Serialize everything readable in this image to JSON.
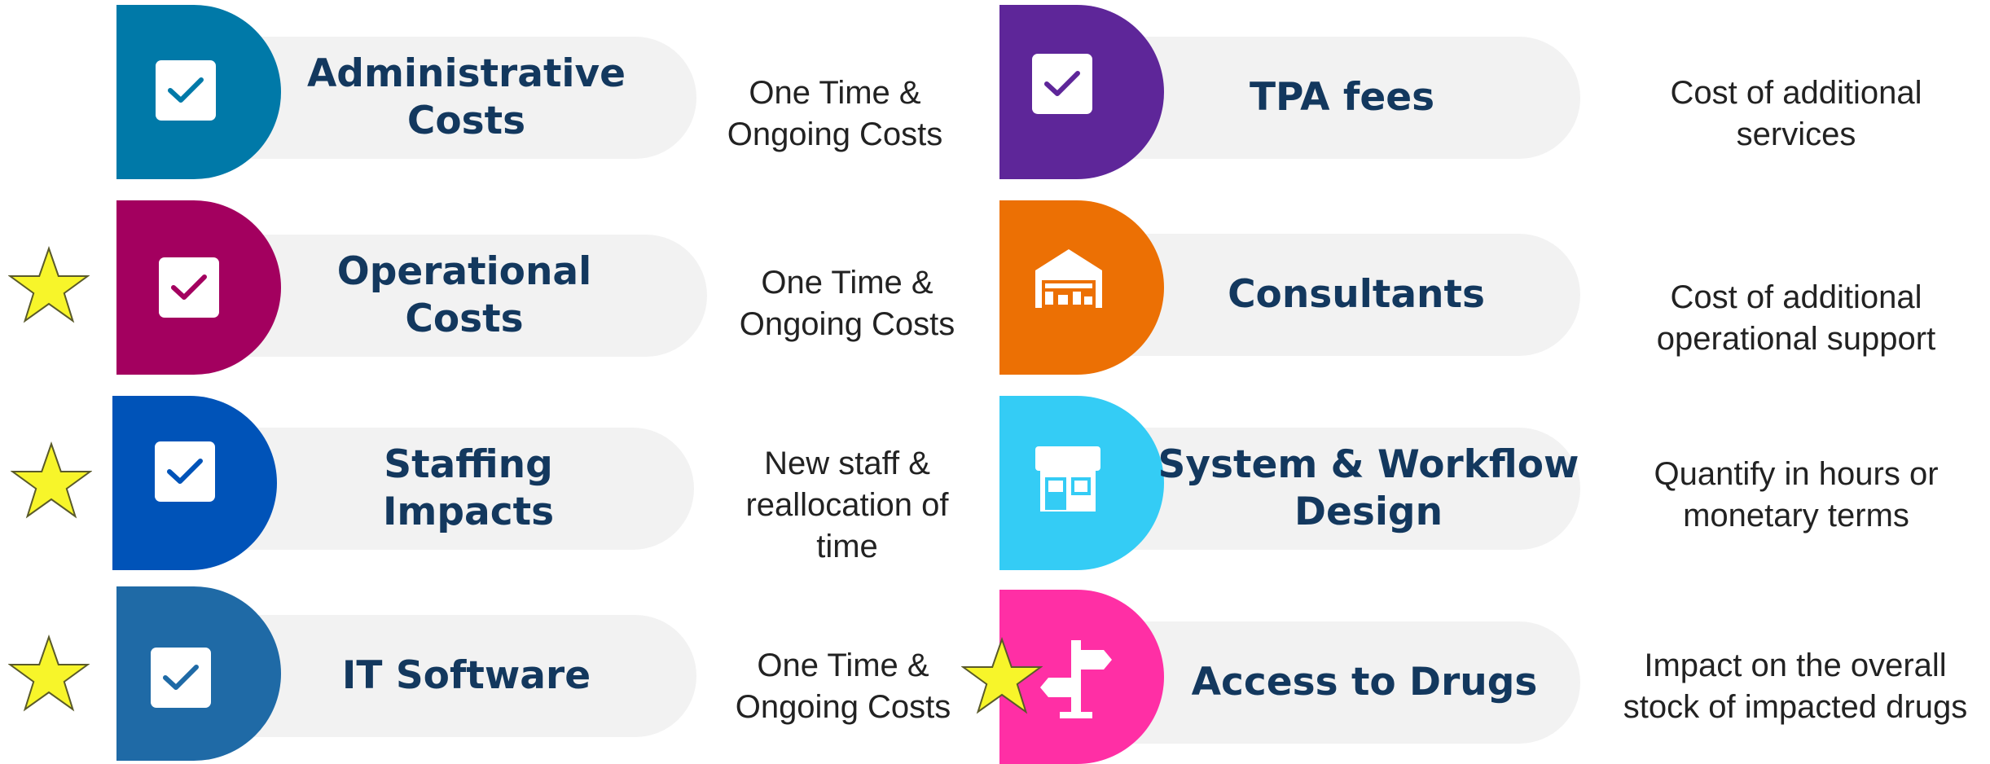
{
  "colors": {
    "text_dark": "#13385e",
    "pill_bg": "#f2f2f2",
    "star_fill": "#f7f52a",
    "star_stroke": "#5a5a2a"
  },
  "left": [
    {
      "title_line1": "Administrative",
      "title_line2": "Costs",
      "desc_line1": "One Time &",
      "desc_line2": "Ongoing Costs",
      "desc_line3": "",
      "color": "#0079a8",
      "icon": "checkbox-icon",
      "starred": false
    },
    {
      "title_line1": "Operational",
      "title_line2": "Costs",
      "desc_line1": "One Time &",
      "desc_line2": "Ongoing Costs",
      "desc_line3": "",
      "color": "#a3005f",
      "icon": "checkbox-icon",
      "starred": true
    },
    {
      "title_line1": "Staffing",
      "title_line2": "Impacts",
      "desc_line1": "New staff &",
      "desc_line2": "reallocation of",
      "desc_line3": "time",
      "color": "#0053b8",
      "icon": "checkbox-icon",
      "starred": true
    },
    {
      "title_line1": "IT Software",
      "title_line2": "",
      "desc_line1": "One Time &",
      "desc_line2": "Ongoing Costs",
      "desc_line3": "",
      "color": "#1f6aa6",
      "icon": "checkbox-icon",
      "starred": true
    }
  ],
  "right": [
    {
      "title_line1": "TPA fees",
      "title_line2": "",
      "desc_line1": "Cost of additional",
      "desc_line2": "services",
      "color": "#5e2699",
      "icon": "checkbox-icon",
      "starred": false
    },
    {
      "title_line1": "Consultants",
      "title_line2": "",
      "desc_line1": "Cost of additional",
      "desc_line2": "operational support",
      "color": "#ec7004",
      "icon": "warehouse-icon",
      "starred": false
    },
    {
      "title_line1": "System & Workflow",
      "title_line2": "Design",
      "desc_line1": "Quantify in hours or",
      "desc_line2": "monetary terms",
      "color": "#34ccf5",
      "icon": "storefront-icon",
      "starred": false
    },
    {
      "title_line1": "Access to Drugs",
      "title_line2": "",
      "desc_line1": "Impact on the overall",
      "desc_line2": "stock of impacted drugs",
      "color": "#ff2fa5",
      "icon": "signpost-icon",
      "starred": true
    }
  ]
}
